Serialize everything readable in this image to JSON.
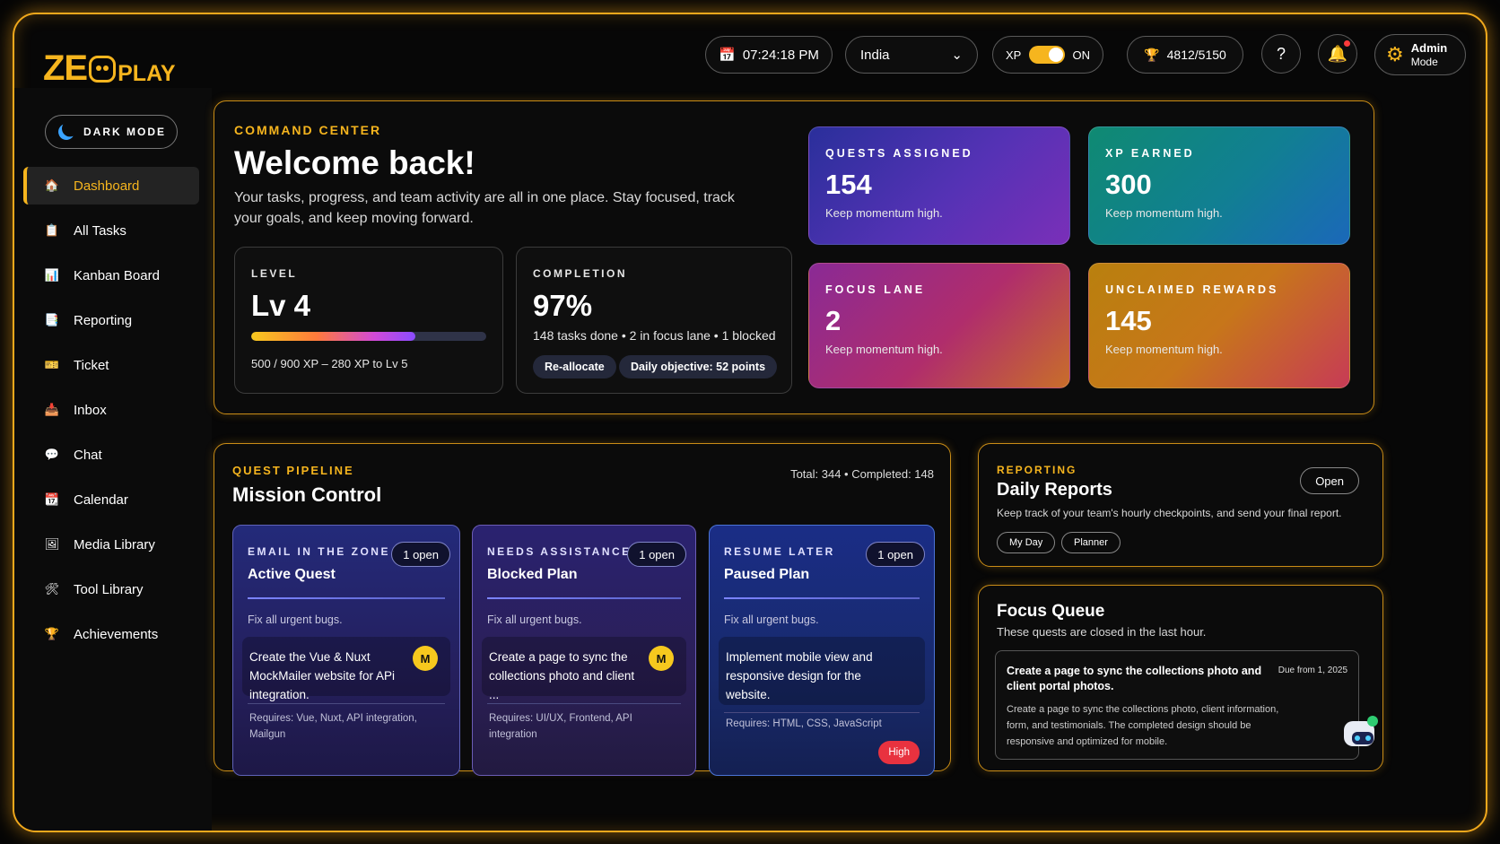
{
  "header": {
    "logo_ze": "ZE",
    "logo_play": "PLAY",
    "time": "07:24:18 PM",
    "country": "India",
    "xp_label": "XP",
    "xp_state": "ON",
    "trophy_score": "4812/5150",
    "admin_title": "Admin",
    "admin_sub": "Mode"
  },
  "sidebar": {
    "dark_mode_label": "DARK MODE",
    "items": [
      {
        "label": "Dashboard"
      },
      {
        "label": "All Tasks"
      },
      {
        "label": "Kanban Board"
      },
      {
        "label": "Reporting"
      },
      {
        "label": "Ticket"
      },
      {
        "label": "Inbox"
      },
      {
        "label": "Chat"
      },
      {
        "label": "Calendar"
      },
      {
        "label": "Media Library"
      },
      {
        "label": "Tool Library"
      },
      {
        "label": "Achievements"
      }
    ]
  },
  "command_center": {
    "kicker": "COMMAND CENTER",
    "title": "Welcome back!",
    "lead": "Your tasks, progress, and team activity are all in one place. Stay focused, track your goals, and keep moving forward.",
    "level": {
      "label": "LEVEL",
      "value": "Lv 4",
      "progress": 0.7,
      "detail": "500  /  900 XP – 280 XP to Lv 5"
    },
    "completion": {
      "label": "COMPLETION",
      "value": "97%",
      "detail": "148 tasks done • 2 in focus lane • 1 blocked",
      "chip1": "Re-allocate",
      "chip2": "Daily objective: 52 points"
    },
    "stats": [
      {
        "label": "QUESTS ASSIGNED",
        "value": "154",
        "note": "Keep momentum high."
      },
      {
        "label": "XP EARNED",
        "value": "300",
        "note": "Keep momentum high."
      },
      {
        "label": "FOCUS LANE",
        "value": "2",
        "note": "Keep momentum high."
      },
      {
        "label": "UNCLAIMED REWARDS",
        "value": "145",
        "note": "Keep momentum high."
      }
    ]
  },
  "pipeline": {
    "kicker": "QUEST PIPELINE",
    "title": "Mission Control",
    "totals": "Total: 344 • Completed: 148",
    "cards": [
      {
        "label": "EMAIL IN THE ZONE",
        "name": "Active Quest",
        "open": "1 open",
        "fix": "Fix all urgent bugs.",
        "task": "Create the Vue & Nuxt MockMailer website for APi integration.",
        "avatar": "M",
        "req": "Requires: Vue, Nuxt, API integration, Mailgun"
      },
      {
        "label": "NEEDS ASSISTANCE",
        "name": "Blocked Plan",
        "open": "1 open",
        "fix": "Fix all urgent bugs.",
        "task": "Create a page to sync the collections photo and client ...",
        "avatar": "M",
        "req": "Requires: UI/UX, Frontend, API integration"
      },
      {
        "label": "RESUME LATER",
        "name": "Paused Plan",
        "open": "1 open",
        "fix": "Fix all urgent bugs.",
        "task": "Implement mobile view and responsive design for the website.",
        "req": "Requires: HTML, CSS, JavaScript",
        "priority": "High"
      }
    ]
  },
  "reporting": {
    "kicker": "REPORTING",
    "title": "Daily Reports",
    "desc": "Keep track of your team's hourly checkpoints, and send your final report.",
    "open_label": "Open",
    "tag1": "My Day",
    "tag2": "Planner"
  },
  "focus_queue": {
    "title": "Focus Queue",
    "desc": "These quests are closed in the last hour.",
    "item_title": "Create a page to sync the collections photo and client portal photos.",
    "item_due": "Due from 1, 2025",
    "item_body": "Create a page to sync the collections photo, client information, form, and testimonials. The completed design should be responsive and optimized for mobile."
  },
  "colors": {
    "accent": "#f6b51e",
    "danger": "#e8323f"
  }
}
